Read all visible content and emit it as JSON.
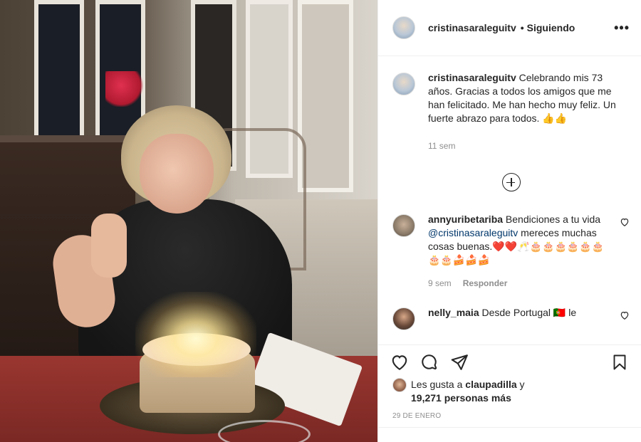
{
  "post": {
    "author": {
      "username": "cristinasaraleguitv",
      "follow_separator": "•",
      "follow_status": "Siguiendo",
      "more_icon": "more-dots-icon",
      "more_label": "•••"
    },
    "caption": {
      "username": "cristinasaraleguitv",
      "text": "Celebrando mis 73 años. Gracias a todos los amigos que me han felicitado. Me han hecho muy feliz. Un fuerte abrazo para todos. 👍👍",
      "time": "11 sem"
    },
    "load_more_icon": "plus-circle-icon",
    "comments": [
      {
        "username": "annyuribetariba",
        "text_before": "Bendiciones a tu vida ",
        "mention": "@cristinasaraleguitv",
        "text_after": " mereces muchas cosas buenas.❤️❤️🥂🎂🎂🎂🎂🎂🎂🎂🎂🍰🍰🍰",
        "time": "9 sem",
        "reply_label": "Responder"
      },
      {
        "username": "nelly_maia",
        "text": "Desde Portugal 🇵🇹 le"
      }
    ],
    "actions": {
      "like_icon": "heart-icon",
      "comment_icon": "comment-bubble-icon",
      "share_icon": "paper-plane-icon",
      "save_icon": "bookmark-icon"
    },
    "likes": {
      "prefix": "Les gusta a ",
      "first_user": "claupadilla",
      "connector": " y",
      "others": "19,271 personas más"
    },
    "date": "29 DE ENERO"
  },
  "colors": {
    "text": "#262626",
    "secondary": "#8e8e8e",
    "mention": "#00376b",
    "border": "#efefef"
  }
}
